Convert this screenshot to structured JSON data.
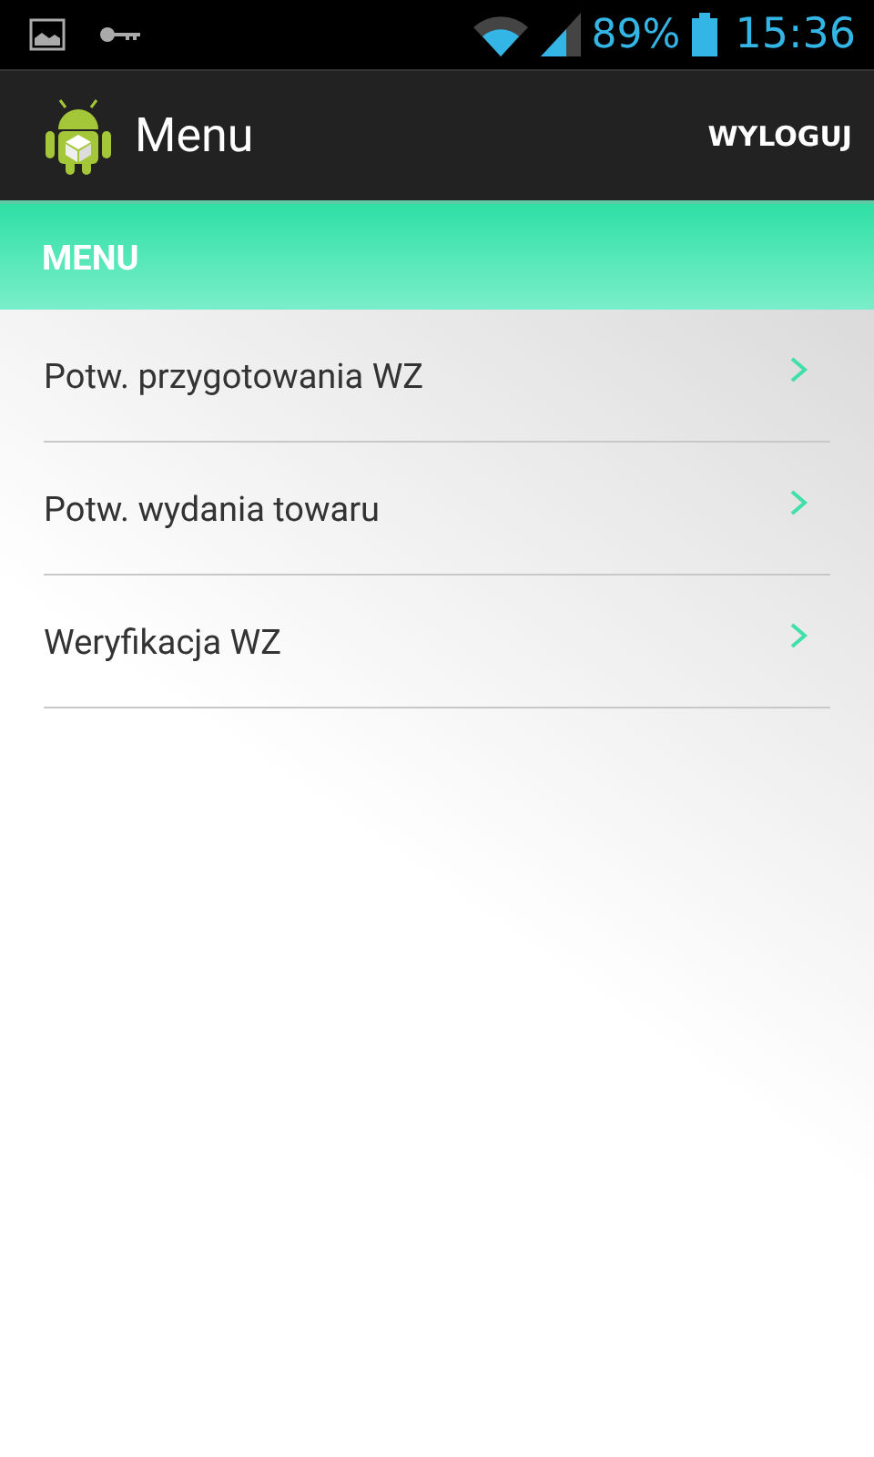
{
  "status_bar": {
    "battery": "89%",
    "time": "15:36"
  },
  "action_bar": {
    "title": "Menu",
    "action": "WYLOGUJ"
  },
  "section": {
    "title": "MENU"
  },
  "items": [
    {
      "label": "Potw. przygotowania WZ"
    },
    {
      "label": "Potw. wydania towaru"
    },
    {
      "label": "Weryfikacja WZ"
    }
  ]
}
